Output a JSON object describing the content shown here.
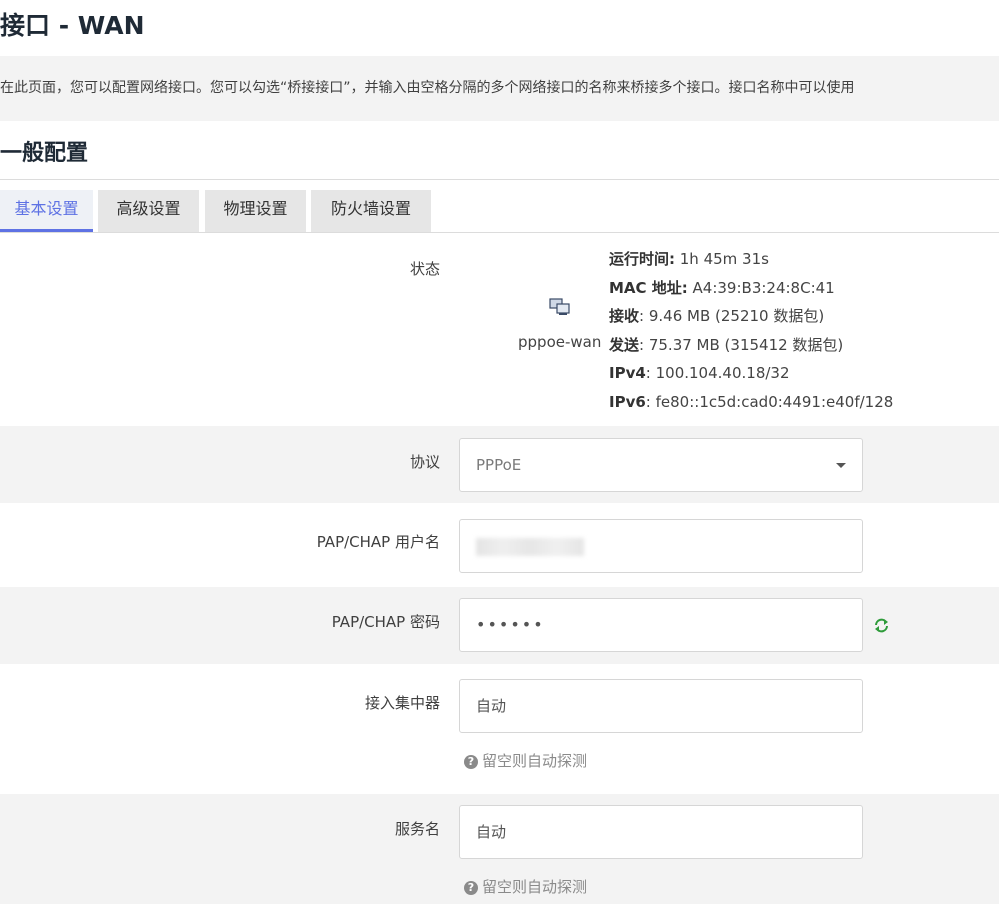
{
  "page": {
    "title": "接口 - WAN",
    "description": "在此页面，您可以配置网络接口。您可以勾选“桥接接口”，并输入由空格分隔的多个网络接口的名称来桥接多个接口。接口名称中可以使用"
  },
  "section": {
    "title": "一般配置"
  },
  "tabs": [
    {
      "label": "基本设置",
      "active": true
    },
    {
      "label": "高级设置",
      "active": false
    },
    {
      "label": "物理设置",
      "active": false
    },
    {
      "label": "防火墙设置",
      "active": false
    }
  ],
  "status": {
    "label": "状态",
    "icon": "network-interface-icon",
    "iface_name": "pppoe-wan",
    "uptime_key": "运行时间:",
    "uptime_val": " 1h 45m 31s",
    "mac_key": "MAC 地址:",
    "mac_val": " A4:39:B3:24:8C:41",
    "rx_key": "接收",
    "rx_val": ": 9.46 MB (25210 数据包)",
    "tx_key": "发送",
    "tx_val": ": 75.37 MB (315412 数据包)",
    "ipv4_key": "IPv4",
    "ipv4_val": ": 100.104.40.18/32",
    "ipv6_key": "IPv6",
    "ipv6_val": ": fe80::1c5d:cad0:4491:e40f/128"
  },
  "protocol": {
    "label": "协议",
    "value": "PPPoE"
  },
  "username": {
    "label": "PAP/CHAP 用户名"
  },
  "password": {
    "label": "PAP/CHAP 密码",
    "value": "••••••",
    "reveal_icon": "refresh-reveal-icon"
  },
  "concentrator": {
    "label": "接入集中器",
    "value": "自动",
    "hint_icon": "?",
    "hint": "留空则自动探测"
  },
  "service": {
    "label": "服务名",
    "value": "自动",
    "hint_icon": "?",
    "hint": "留空则自动探测"
  },
  "colors": {
    "accent": "#5e72e4",
    "shade": "#f3f3f3",
    "reveal": "#2e9b3a"
  }
}
